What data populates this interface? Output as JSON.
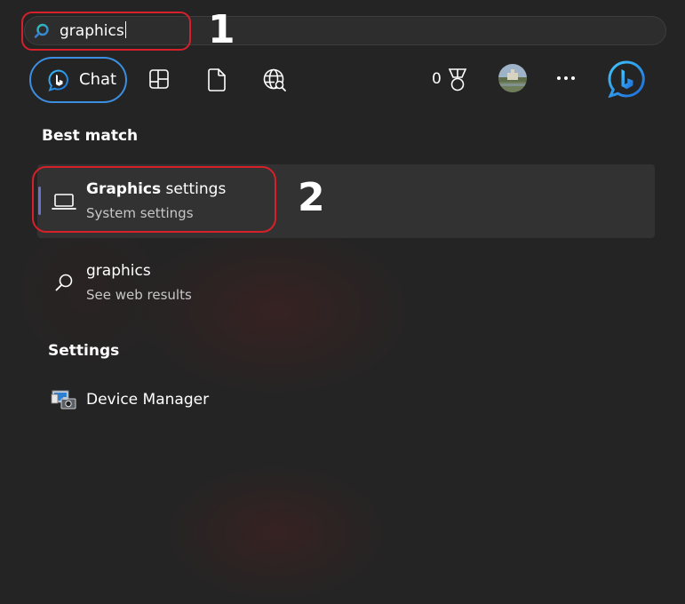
{
  "search": {
    "query": "graphics"
  },
  "annotations": {
    "one": "1",
    "two": "2"
  },
  "toolbar": {
    "chat_label": "Chat",
    "rewards_count": "0",
    "accent": "#3c8fe0"
  },
  "best_match": {
    "heading": "Best match",
    "title_bold": "Graphics",
    "title_rest": " settings",
    "subtitle": "System settings"
  },
  "web_result": {
    "title": "graphics",
    "subtitle": "See web results"
  },
  "settings": {
    "heading": "Settings",
    "items": [
      {
        "label": "Device Manager"
      }
    ]
  }
}
